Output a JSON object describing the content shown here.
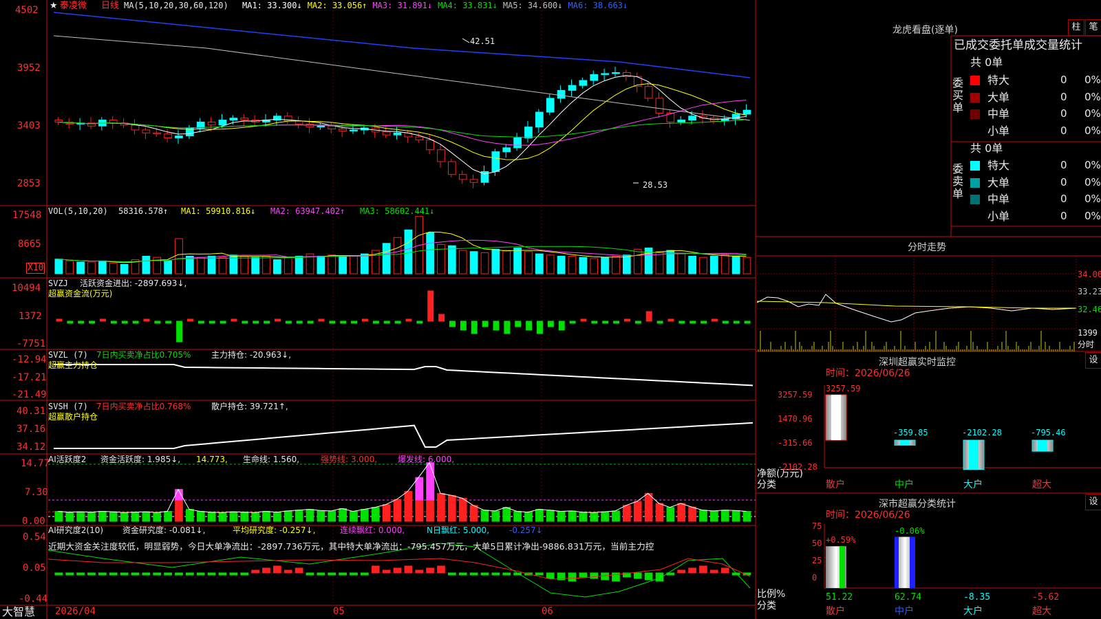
{
  "header": {
    "star": "★",
    "stock_name": "泰凌微",
    "period": "日线",
    "ma_params": "MA(5,10,20,30,60,120)",
    "ma": [
      {
        "label": "MA1: 33.300↓",
        "color": "#ffffff"
      },
      {
        "label": "MA2: 33.056↑",
        "color": "#ffff00"
      },
      {
        "label": "MA3: 31.891↓",
        "color": "#ff40ff"
      },
      {
        "label": "MA4: 33.831↓",
        "color": "#00e000"
      },
      {
        "label": "MA5: 34.600↓",
        "color": "#c0c0c0"
      },
      {
        "label": "MA6: 38.663↓",
        "color": "#3060ff"
      }
    ]
  },
  "price_panel": {
    "yticks": [
      "4502",
      "3952",
      "3403",
      "2853"
    ],
    "high_label": "42.51",
    "low_label": "28.53"
  },
  "vol_panel": {
    "title": "VOL(5,10,20)",
    "value": "58316.578↑",
    "ma1": "MA1: 59910.816↓",
    "ma2": "MA2: 63947.402↑",
    "ma3": "MA3: 58602.441↓",
    "yticks": [
      "17548",
      "8665"
    ],
    "unit": "X10"
  },
  "svzj_panel": {
    "title": "SVZJ",
    "line1": "活跃资金进出: -2897.693↓,",
    "line2": "超赢资金流(万元)",
    "yticks": [
      "10494",
      "1372",
      "-7751"
    ]
  },
  "svzl_panel": {
    "title": "SVZL (7)",
    "ratio": "7日内买卖净占比0.705%",
    "hold": "主力持仓: -20.963↓,",
    "line2": "超赢主力持仓",
    "yticks": [
      "-12.94",
      "-17.21",
      "-21.49"
    ]
  },
  "svsh_panel": {
    "title": "SVSH (7)",
    "ratio": "7日内买卖净占比0.768%",
    "hold": "散户持仓: 39.721↑,",
    "line2": "超赢散户持仓",
    "yticks": [
      "40.31",
      "37.16",
      "34.12"
    ]
  },
  "ai_active_panel": {
    "title": "AI活跃度2",
    "val1": "资金活跃度: 1.985↓,",
    "val2": "14.773,",
    "val3": "生命线: 1.560,",
    "val4": "强势线: 3.000,",
    "val5": "爆发线: 6.000,",
    "yticks": [
      "14.77",
      "7.30",
      "0.00"
    ]
  },
  "ai_research_panel": {
    "title": "AI研究度2(10)",
    "val1": "资金研究度: -0.081↓,",
    "val2": "平均研究度: -0.257↓,",
    "val3": "连续飘红: 0.000,",
    "val4": "N日飘红: 5.000,",
    "val5": "-0.257↓",
    "commentary": "近期大资金关注度较低，明显弱势，今日大单净流出：-2897.736万元，其中特大单净流出：-795.457万元，大单5日累计净出-9886.831万元，当前主力控",
    "yticks": [
      "0.54",
      "0.05",
      "-0.44"
    ]
  },
  "bottom_bar": {
    "app_name": "大智慧",
    "dates": [
      "2026/04",
      "05",
      "06"
    ]
  },
  "longhu": {
    "title": "龙虎看盘(逐单)",
    "btn1": "柱",
    "btn2": "笔",
    "subtitle": "已成交委托单成交量统计",
    "buy_side": "委买单",
    "sell_side": "委卖单",
    "buy_total": "共 0单",
    "sell_total": "共 0单",
    "buy_rows": [
      {
        "name": "特大",
        "count": "0",
        "pct": "0%",
        "color": "#ff0000"
      },
      {
        "name": "大单",
        "count": "0",
        "pct": "0%",
        "color": "#a00000"
      },
      {
        "name": "中单",
        "count": "0",
        "pct": "0%",
        "color": "#700000"
      },
      {
        "name": "小单",
        "count": "0",
        "pct": "0%",
        "color": "#000000"
      }
    ],
    "sell_rows": [
      {
        "name": "特大",
        "count": "0",
        "pct": "0%",
        "color": "#00ffff"
      },
      {
        "name": "大单",
        "count": "0",
        "pct": "0%",
        "color": "#00a0a0"
      },
      {
        "name": "中单",
        "count": "0",
        "pct": "0%",
        "color": "#007070"
      },
      {
        "name": "小单",
        "count": "0",
        "pct": "0%",
        "color": "#000000"
      }
    ]
  },
  "intraday": {
    "title": "分时走势",
    "yticks": [
      "34.00",
      "33.23",
      "32.46"
    ],
    "vol_tick": "1399",
    "vol_unit": "分时"
  },
  "sz_monitor": {
    "title": "深圳超赢实时监控",
    "btn": "设",
    "time": "时间：2026/06/26",
    "yticks": [
      "3257.59",
      "1470.96",
      "-315.66",
      "-2102.28"
    ],
    "ylabel1": "净额(万元)",
    "ylabel2": "分类",
    "categories": [
      "散户",
      "中户",
      "大户",
      "超大"
    ],
    "values": [
      "3257.59",
      "-359.85",
      "-2102.28",
      "-795.46"
    ]
  },
  "sz_class": {
    "title": "深市超赢分类统计",
    "btn": "设",
    "time": "时间：2026/06/26",
    "yticks": [
      "75",
      "50",
      "25",
      "0"
    ],
    "ylabel1": "比例%",
    "ylabel2": "分类",
    "categories": [
      "散户",
      "中户",
      "大户",
      "超大"
    ],
    "top_labels": [
      "+0.59%",
      "-0.06%",
      "",
      ""
    ],
    "bottom_values": [
      "51.22",
      "62.74",
      "-8.35",
      "-5.62"
    ]
  }
}
